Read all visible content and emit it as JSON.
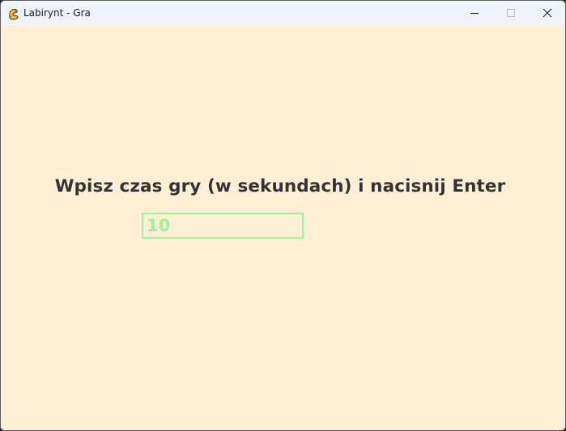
{
  "window": {
    "title": "Labirynt - Gra",
    "app_icon": "pygame-snake-icon",
    "controls": {
      "minimize_icon": "minimize-icon",
      "maximize_icon": "maximize-icon",
      "close_icon": "close-icon"
    }
  },
  "game": {
    "prompt": "Wpisz czas gry (w sekundach) i nacisnij Enter",
    "time_input": {
      "value": "10"
    }
  },
  "colors": {
    "background": "#ffefd5",
    "prompt_text": "#333333",
    "input_accent": "#98f598",
    "titlebar": "#eef4fa"
  }
}
